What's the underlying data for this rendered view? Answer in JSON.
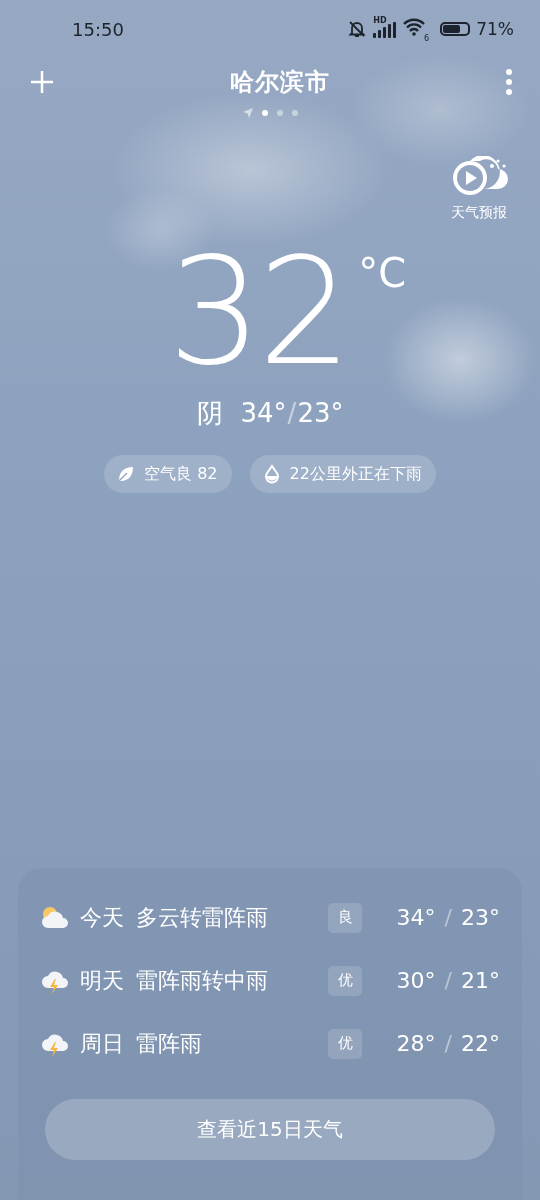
{
  "status_bar": {
    "time": "15:50",
    "signal_label": "HD",
    "wifi_label": "6",
    "battery_text": "71%"
  },
  "header": {
    "city": "哈尔滨市",
    "page_dots": [
      {
        "kind": "location",
        "selected": false
      },
      {
        "kind": "dot",
        "selected": true
      },
      {
        "kind": "dot",
        "selected": false
      },
      {
        "kind": "dot",
        "selected": false
      }
    ]
  },
  "forecast_video": {
    "label": "天气预报"
  },
  "current": {
    "temperature": "32",
    "unit": "°C",
    "condition": "阴",
    "high": "34°",
    "separator": "/",
    "low": "23°"
  },
  "chips": [
    {
      "kind": "air",
      "text": "空气良 82"
    },
    {
      "kind": "rain",
      "text": "22公里外正在下雨"
    }
  ],
  "forecast": {
    "rows": [
      {
        "kind": "cloudy_sun",
        "day": "今天",
        "condition": "多云转雷阵雨",
        "aqi": "良",
        "high": "34°",
        "separator": "/",
        "low": "23°"
      },
      {
        "kind": "thunder",
        "day": "明天",
        "condition": "雷阵雨转中雨",
        "aqi": "优",
        "high": "30°",
        "separator": "/",
        "low": "21°"
      },
      {
        "kind": "thunder",
        "day": "周日",
        "condition": "雷阵雨",
        "aqi": "优",
        "high": "28°",
        "separator": "/",
        "low": "22°"
      }
    ],
    "button": "查看近15日天气"
  }
}
